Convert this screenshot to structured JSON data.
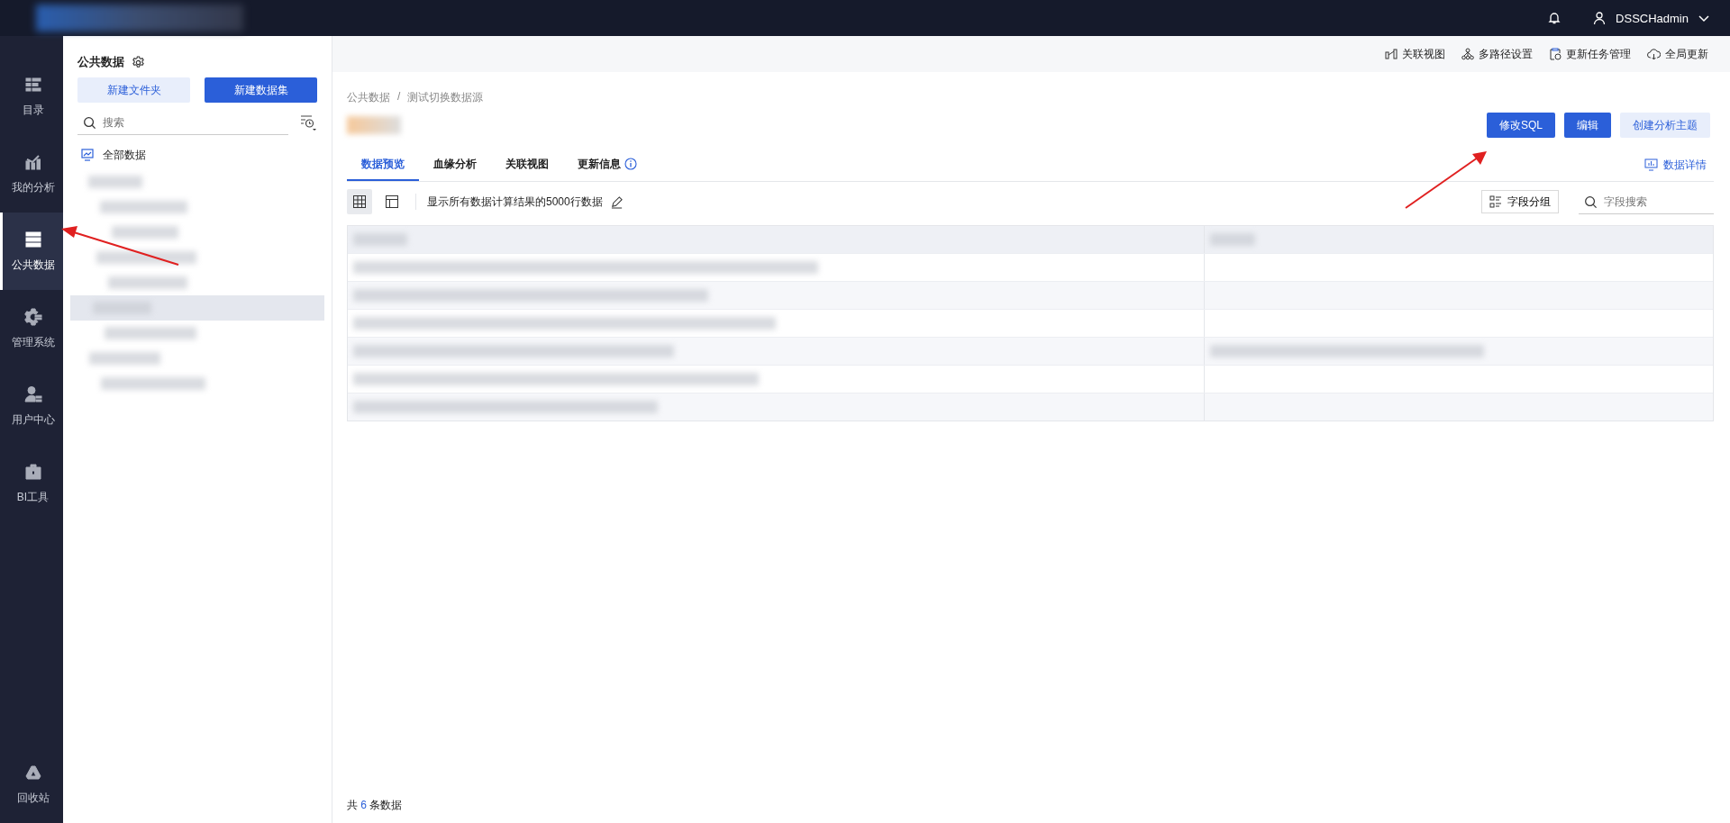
{
  "top_bar": {
    "user": "DSSCHadmin"
  },
  "nav": [
    {
      "label": "目录",
      "selected": false
    },
    {
      "label": "我的分析",
      "selected": false
    },
    {
      "label": "公共数据",
      "selected": true
    },
    {
      "label": "管理系统",
      "selected": false
    },
    {
      "label": "用户中心",
      "selected": false
    },
    {
      "label": "BI工具",
      "selected": false
    }
  ],
  "nav_bottom": {
    "label": "回收站"
  },
  "folder_panel": {
    "title": "公共数据",
    "buttons": [
      {
        "label": "新建文件夹",
        "kind": "secondary"
      },
      {
        "label": "新建数据集",
        "kind": "primary"
      }
    ],
    "search": {
      "placeholder": "搜索"
    },
    "root": "全部数据",
    "items": [
      {
        "selected": false
      },
      {
        "selected": false
      },
      {
        "selected": false
      },
      {
        "selected": false
      },
      {
        "selected": false
      },
      {
        "selected": true
      },
      {
        "selected": false
      },
      {
        "selected": false
      },
      {
        "selected": false
      }
    ]
  },
  "toolbar": [
    "关联视图",
    "多路径设置",
    "更新任务管理",
    "全局更新"
  ],
  "breadcrumb": {
    "items": [
      "公共数据",
      "测试切换数据源"
    ],
    "separator": "/"
  },
  "actions": [
    {
      "label": "修改SQL",
      "kind": "primary"
    },
    {
      "label": "编辑",
      "kind": "primary"
    },
    {
      "label": "创建分析主题",
      "kind": "secondary"
    }
  ],
  "tabs": [
    {
      "label": "数据预览",
      "selected": true,
      "info": false
    },
    {
      "label": "血缘分析",
      "selected": false,
      "info": false
    },
    {
      "label": "关联视图",
      "selected": false,
      "info": false
    },
    {
      "label": "更新信息",
      "selected": false,
      "info": true
    }
  ],
  "detail_link": "数据详情",
  "view_modes": [
    {
      "selected": true
    },
    {
      "selected": false
    }
  ],
  "preview_note": "显示所有数据计算结果的5000行数据",
  "field_group": "字段分组",
  "field_search": {
    "placeholder": "字段搜索"
  },
  "table": {
    "rows": [
      {
        "kind": "redacted"
      },
      {
        "kind": "redacted"
      },
      {
        "kind": "redacted"
      },
      {
        "kind": "redacted"
      },
      {
        "kind": "redacted"
      },
      {
        "kind": "redacted"
      }
    ]
  },
  "footer": {
    "prefix": "共",
    "count": "6",
    "suffix": "条数据"
  }
}
